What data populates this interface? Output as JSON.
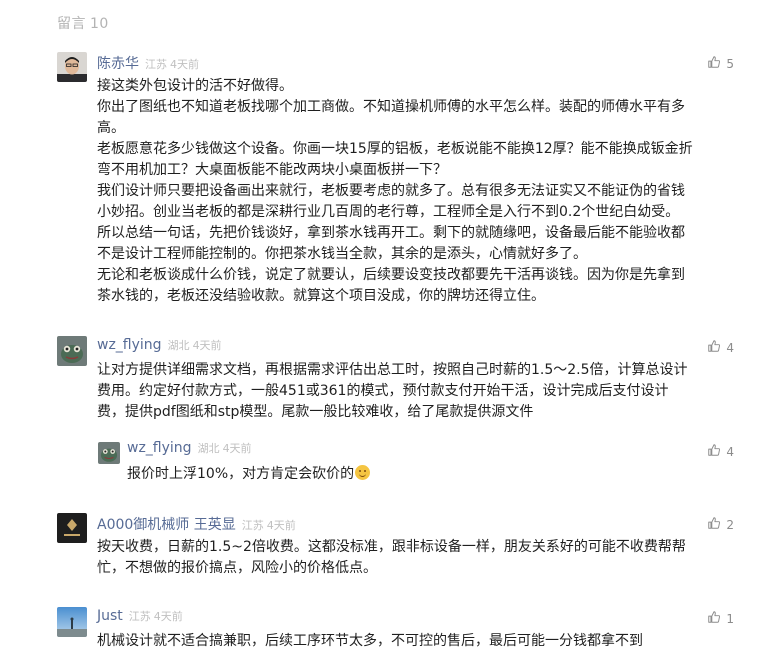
{
  "header": {
    "label": "留言",
    "count": "10"
  },
  "comments": [
    {
      "author": "陈赤华",
      "region": "江苏",
      "time": "4天前",
      "likes": "5",
      "lines": [
        "接这类外包设计的活不好做得。",
        "你出了图纸也不知道老板找哪个加工商做。不知道操机师傅的水平怎么样。装配的师傅水平有多",
        "高。",
        "老板愿意花多少钱做这个设备。你画一块15厚的铝板，老板说能不能换12厚？能不能换成钣金折",
        "弯不用机加工？大桌面板能不能改两块小桌面板拼一下？",
        "我们设计师只要把设备画出来就行，老板要考虑的就多了。总有很多无法证实又不能证伪的省钱",
        "小妙招。创业当老板的都是深耕行业几百周的老行尊，工程师全是入行不到0.2个世纪白幼受。",
        "所以总结一句话，先把价钱谈好，拿到茶水钱再开工。剩下的就随缘吧，设备最后能不能验收都",
        "不是设计工程师能控制的。你把茶水钱当全款，其余的是添头，心情就好多了。",
        "无论和老板谈成什么价钱，说定了就要认，后续要设变技改都要先干活再谈钱。因为你是先拿到",
        "茶水钱的，老板还没结验收款。就算这个项目没成，你的牌坊还得立住。"
      ]
    },
    {
      "author": "wz_flying",
      "region": "湖北",
      "time": "4天前",
      "likes": "4",
      "lines": [
        "让对方提供详细需求文档，再根据需求评估出总工时，按照自己时薪的1.5～2.5倍，计算总设计",
        "费用。约定好付款方式，一般451或361的模式，预付款支付开始干活，设计完成后支付设计",
        "费，提供pdf图纸和stp模型。尾款一般比较难收，给了尾款提供源文件"
      ]
    },
    {
      "author": "A000御机械师 王英显",
      "region": "江苏",
      "time": "4天前",
      "likes": "2",
      "lines": [
        "按天收费，日薪的1.5~2倍收费。这都没标准，跟非标设备一样，朋友关系好的可能不收费帮帮",
        "忙，不想做的报价搞点，风险小的价格低点。"
      ]
    },
    {
      "author": "Just",
      "region": "江苏",
      "time": "4天前",
      "likes": "1",
      "lines": [
        "机械设计就不适合搞兼职，后续工序环节太多，不可控的售后，最后可能一分钱都拿不到"
      ]
    }
  ],
  "reply": {
    "author": "wz_flying",
    "region": "湖北",
    "time": "4天前",
    "likes": "4",
    "text": "报价时上浮10%，对方肯定会砍价的",
    "emoji": "smile-emoji"
  },
  "icons": {
    "like": "thumbs-up-icon"
  },
  "colors": {
    "author": "#576b95",
    "meta": "#c0c0c0",
    "text": "#1f1f1f",
    "header": "#b3b3b3"
  }
}
